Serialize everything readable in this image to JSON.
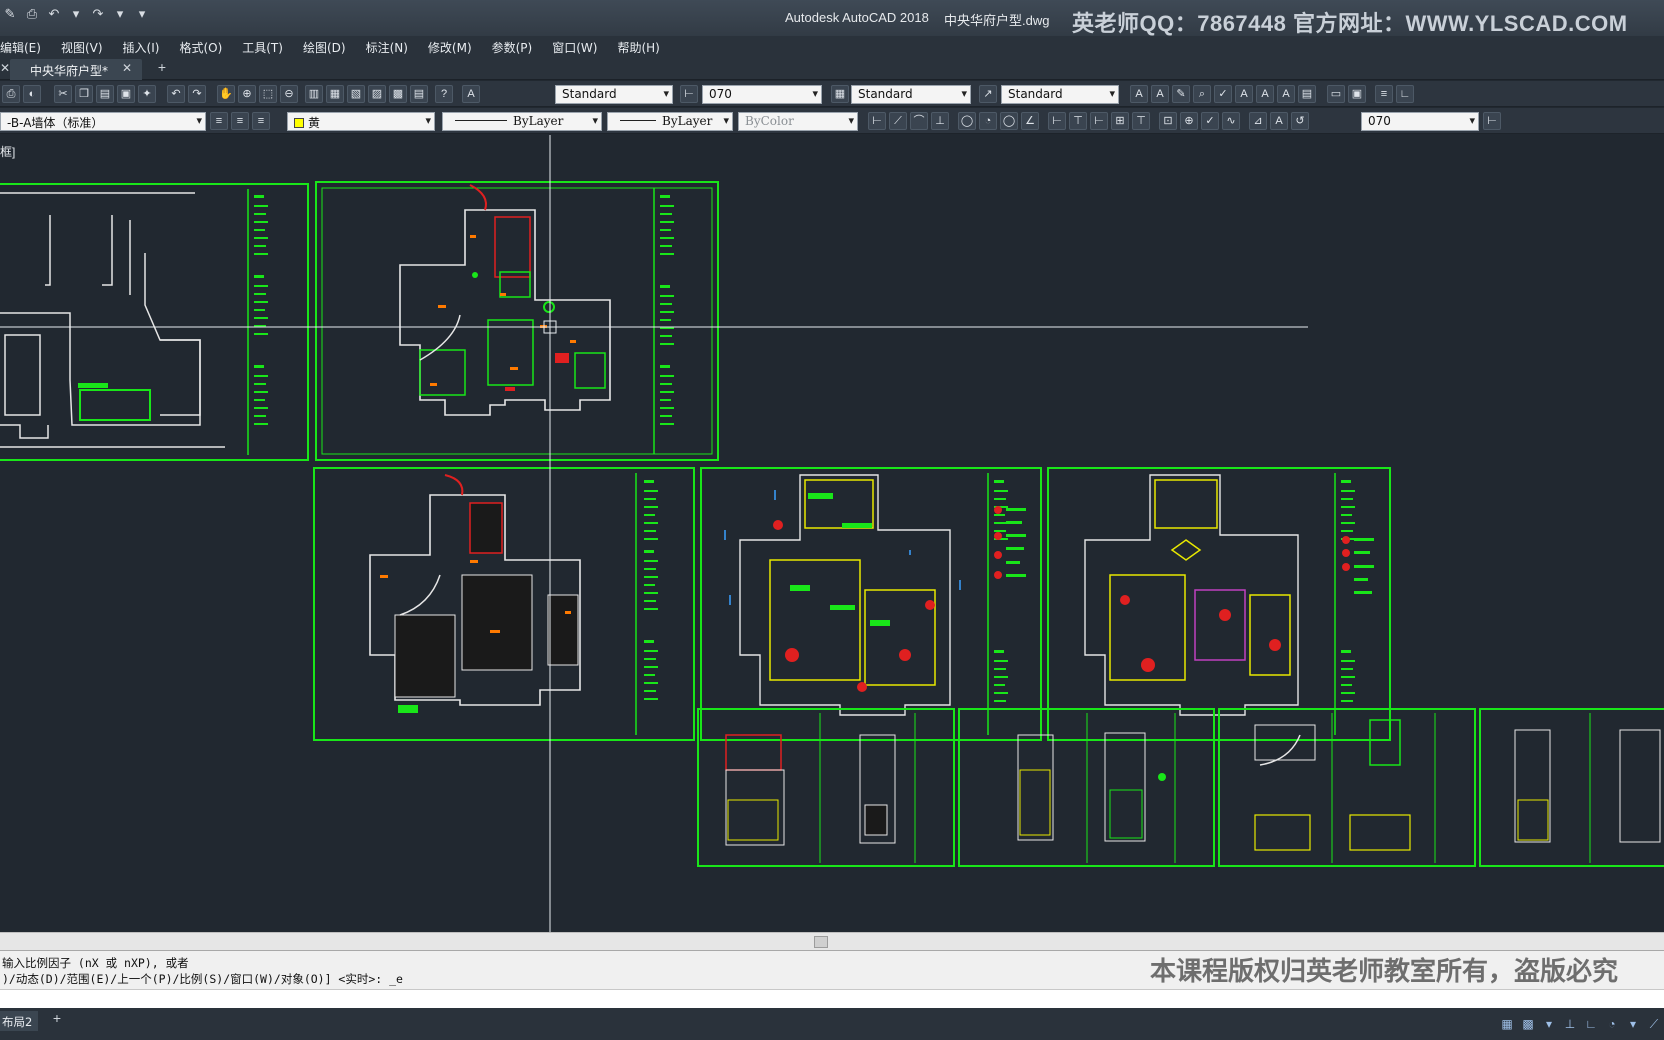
{
  "titlebar": {
    "app_title": "Autodesk AutoCAD 2018",
    "doc_title": "中央华府户型.dwg",
    "watermark": "英老师QQ：7867448  官方网址：WWW.YLSCAD.COM"
  },
  "menu": {
    "items": [
      "编辑(E)",
      "视图(V)",
      "插入(I)",
      "格式(O)",
      "工具(T)",
      "绘图(D)",
      "标注(N)",
      "修改(M)",
      "参数(P)",
      "窗口(W)",
      "帮助(H)"
    ]
  },
  "tabs": {
    "document": "中央华府户型*",
    "close": "✕",
    "new": "+"
  },
  "toolbar1": {
    "text_style": "Standard",
    "dim_style": "070",
    "table_style": "Standard",
    "multileader_style": "Standard"
  },
  "toolbar2": {
    "layer": "-B-A墙体（标准）",
    "color": "黄",
    "linetype": "ByLayer",
    "lineweight": "ByLayer",
    "plotstyle": "ByColor",
    "dim_style2": "070"
  },
  "viewport": {
    "label": "框]"
  },
  "command": {
    "line1": "输入比例因子 (nX 或 nXP), 或者",
    "line2": ")/动态(D)/范围(E)/上一个(P)/比例(S)/窗口(W)/对象(O)] <实时>: _e",
    "watermark": "本课程版权归英老师教室所有，盗版必究"
  },
  "status": {
    "layout_tab": "布局2",
    "add": "+"
  },
  "colors": {
    "canvas": "#212830",
    "frame_green": "#19e619",
    "crosshair": "#e8ecf0"
  }
}
